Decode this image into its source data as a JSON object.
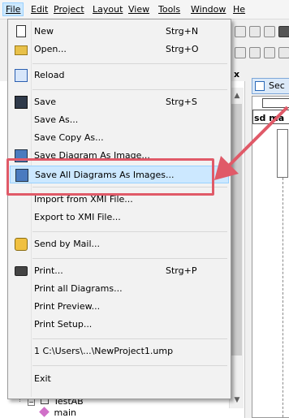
{
  "menubar": {
    "items": [
      {
        "label": "File",
        "mnemonic": "F"
      },
      {
        "label": "Edit",
        "mnemonic": "E"
      },
      {
        "label": "Project",
        "mnemonic": "P"
      },
      {
        "label": "Layout",
        "mnemonic": "L"
      },
      {
        "label": "View",
        "mnemonic": "V"
      },
      {
        "label": "Tools",
        "mnemonic": "T"
      },
      {
        "label": "Window",
        "mnemonic": "W"
      },
      {
        "label": "He",
        "mnemonic": "H"
      }
    ]
  },
  "file_menu": {
    "items": [
      {
        "label": "New",
        "shortcut": "Strg+N",
        "icon": "new-document-icon"
      },
      {
        "label": "Open...",
        "shortcut": "Strg+O",
        "icon": "open-folder-icon"
      },
      {
        "label": "Reload",
        "shortcut": "",
        "icon": "reload-icon"
      },
      {
        "label": "Save",
        "shortcut": "Strg+S",
        "icon": "save-disk-icon"
      },
      {
        "label": "Save As...",
        "shortcut": ""
      },
      {
        "label": "Save Copy As...",
        "shortcut": ""
      },
      {
        "label": "Save Diagram As Image...",
        "shortcut": "",
        "icon": "save-image-icon"
      },
      {
        "label": "Save All Diagrams As Images...",
        "shortcut": "",
        "icon": "save-all-images-icon",
        "highlighted": true
      },
      {
        "label": "Import from XMI File...",
        "shortcut": ""
      },
      {
        "label": "Export to XMI File...",
        "shortcut": ""
      },
      {
        "label": "Send by Mail...",
        "shortcut": "",
        "icon": "mail-icon"
      },
      {
        "label": "Print...",
        "shortcut": "Strg+P",
        "icon": "printer-icon"
      },
      {
        "label": "Print all Diagrams...",
        "shortcut": ""
      },
      {
        "label": "Print Preview...",
        "shortcut": ""
      },
      {
        "label": "Print Setup...",
        "shortcut": ""
      },
      {
        "label": "1 C:\\Users\\...\\NewProject1.ump",
        "shortcut": ""
      },
      {
        "label": "Exit",
        "shortcut": ""
      }
    ]
  },
  "tree": {
    "items": [
      {
        "label": "TestAB"
      },
      {
        "label": "main"
      }
    ]
  },
  "diagram": {
    "tab_label": "Sec",
    "frame_label": "sd ma"
  },
  "panel": {
    "pin_glyph": "ᵖ",
    "close_glyph": "x"
  },
  "colors": {
    "highlight_bg": "#cce8ff",
    "highlight_border": "#99d1ff",
    "callout": "#e05a68"
  }
}
